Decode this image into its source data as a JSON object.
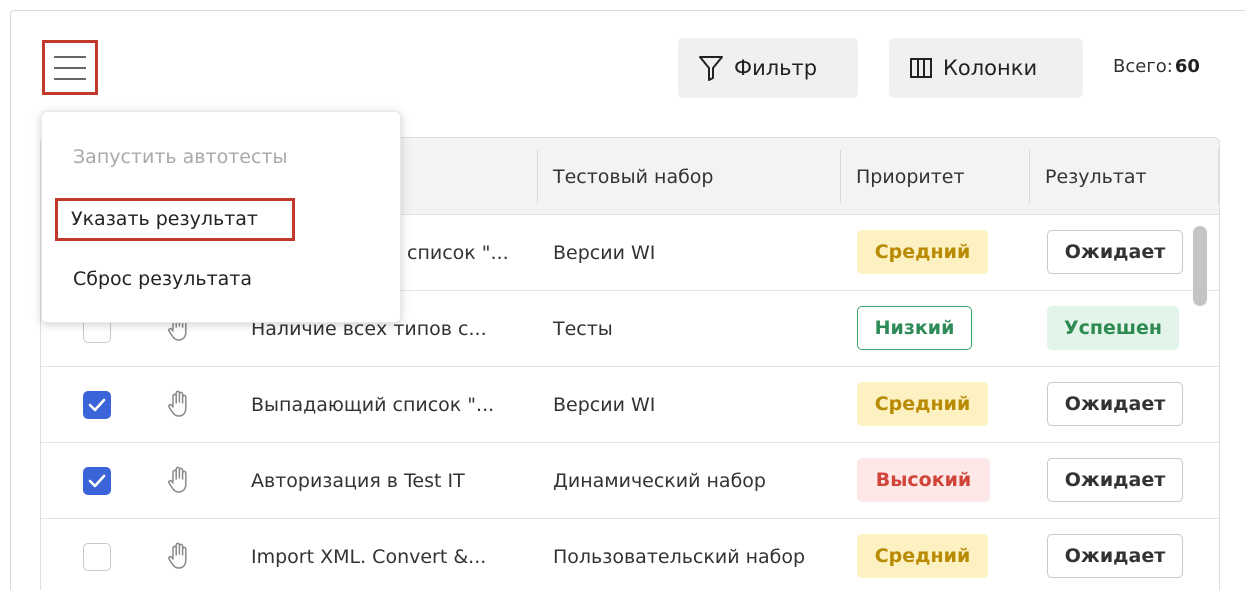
{
  "toolbar": {
    "filter_label": "Фильтр",
    "columns_label": "Колонки",
    "total_label": "Всего:",
    "total_value": "60"
  },
  "menu": {
    "items": [
      {
        "label": "Запустить автотесты",
        "disabled": true
      },
      {
        "label": "Указать результат",
        "highlighted": true
      },
      {
        "label": "Сброс результата"
      }
    ]
  },
  "table": {
    "columns": [
      "Тестовый набор",
      "Приоритет",
      "Результат"
    ],
    "rows": [
      {
        "checked": false,
        "name": "список \"...",
        "suite": "Версии WI",
        "priority": "Средний",
        "result": "Ожидает"
      },
      {
        "checked": false,
        "name": "Наличие всех типов с...",
        "suite": "Тесты",
        "priority": "Низкий",
        "result": "Успешен"
      },
      {
        "checked": true,
        "name": "Выпадающий список \"...",
        "suite": "Версии WI",
        "priority": "Средний",
        "result": "Ожидает"
      },
      {
        "checked": true,
        "name": "Авторизация в Test IT",
        "suite": "Динамический набор",
        "priority": "Высокий",
        "result": "Ожидает"
      },
      {
        "checked": false,
        "name": "Import XML. Convert &...",
        "suite": "Пользовательский набор",
        "priority": "Средний",
        "result": "Ожидает"
      }
    ]
  },
  "colors": {
    "accent_blue": "#3a64d8",
    "highlight_red": "#c0392b",
    "medium_bg": "#fdf1c2",
    "medium_text": "#b78a00",
    "low_border": "#3aa56a",
    "low_text": "#2e8b57",
    "high_bg": "#fde7e7",
    "high_text": "#d0443a",
    "success_bg": "#e3f4ea",
    "success_text": "#2f8a52"
  },
  "icons": {
    "menu": "hamburger-icon",
    "filter": "filter-funnel-icon",
    "columns": "columns-icon",
    "checkbox": "checkmark-icon",
    "manual": "hand-icon"
  }
}
